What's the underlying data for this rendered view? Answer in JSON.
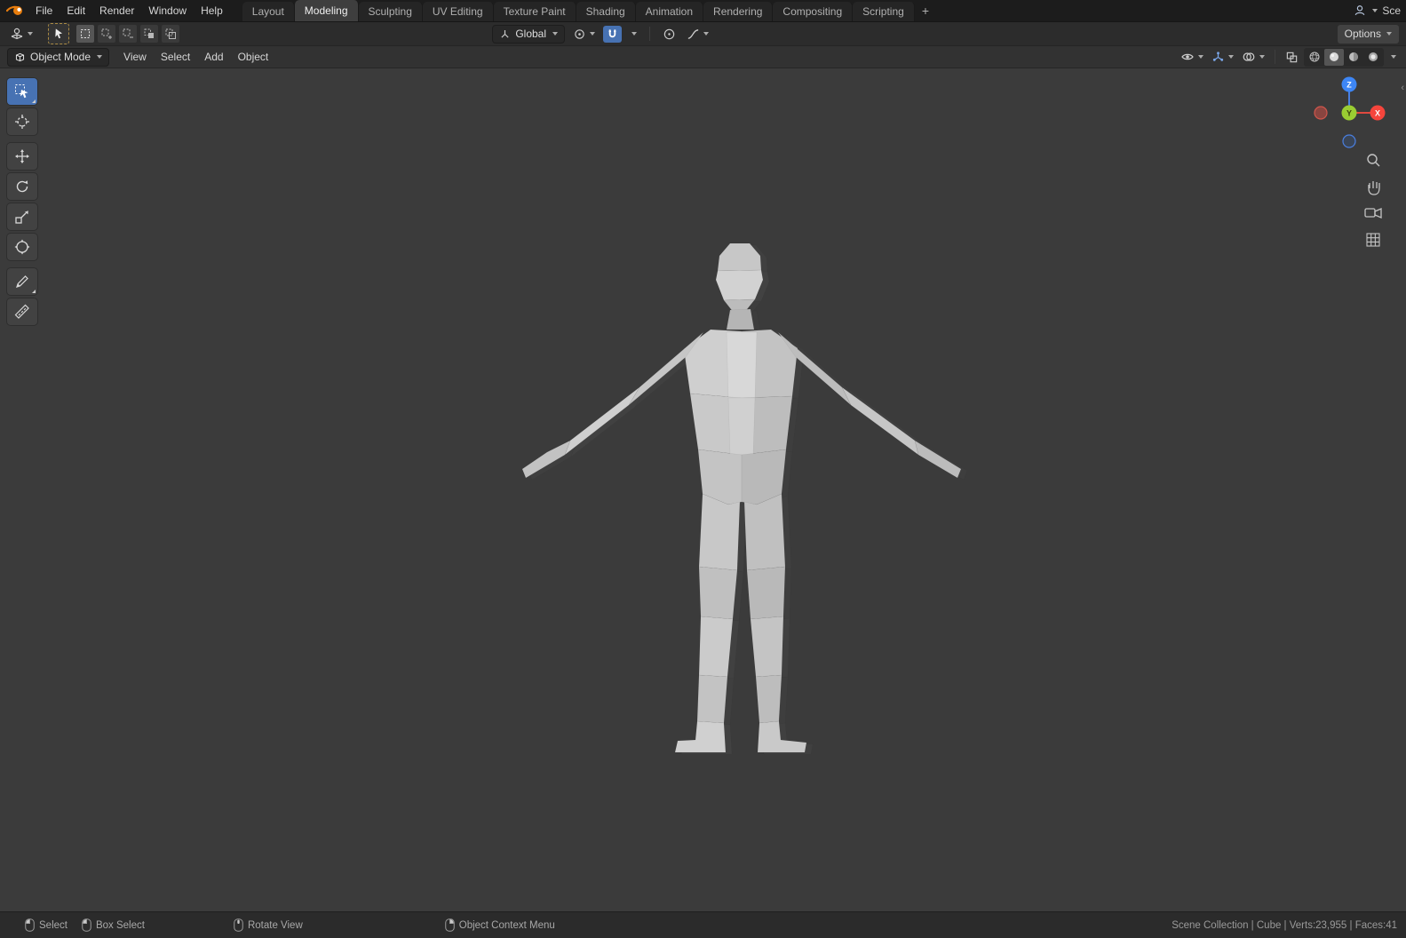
{
  "colors": {
    "accent": "#4772b3",
    "axis_x": "#f5453c",
    "axis_y": "#9acd32",
    "axis_z": "#3d86f5",
    "viewport_bg": "#3b3b3b"
  },
  "topbar": {
    "app": "Blender",
    "menus": [
      {
        "label": "File"
      },
      {
        "label": "Edit"
      },
      {
        "label": "Render"
      },
      {
        "label": "Window"
      },
      {
        "label": "Help"
      }
    ],
    "workspaces": [
      {
        "label": "Layout"
      },
      {
        "label": "Modeling",
        "active": true
      },
      {
        "label": "Sculpting"
      },
      {
        "label": "UV Editing"
      },
      {
        "label": "Texture Paint"
      },
      {
        "label": "Shading"
      },
      {
        "label": "Animation"
      },
      {
        "label": "Rendering"
      },
      {
        "label": "Compositing"
      },
      {
        "label": "Scripting"
      }
    ],
    "add_workspace_label": "+",
    "scene_label": "Sce"
  },
  "tool_settings": {
    "orientation": "Global",
    "options_label": "Options"
  },
  "viewport_header": {
    "mode": "Object Mode",
    "menus": [
      {
        "label": "View"
      },
      {
        "label": "Select"
      },
      {
        "label": "Add"
      },
      {
        "label": "Object"
      }
    ]
  },
  "gizmo": {
    "x_label": "X",
    "y_label": "Y",
    "z_label": "Z"
  },
  "left_toolbar": {
    "tools": [
      "select-box",
      "cursor",
      "move",
      "rotate",
      "scale",
      "transform",
      "annotate",
      "measure"
    ],
    "active_tool": "select-box"
  },
  "status_bar": {
    "hints": [
      {
        "label": "Select",
        "mouse": "left"
      },
      {
        "label": "Box Select",
        "mouse": "left-drag"
      },
      {
        "label": "Rotate View",
        "mouse": "middle"
      },
      {
        "label": "Object Context Menu",
        "mouse": "right"
      }
    ],
    "stats": "Scene Collection | Cube | Verts:23,955 | Faces:41"
  }
}
